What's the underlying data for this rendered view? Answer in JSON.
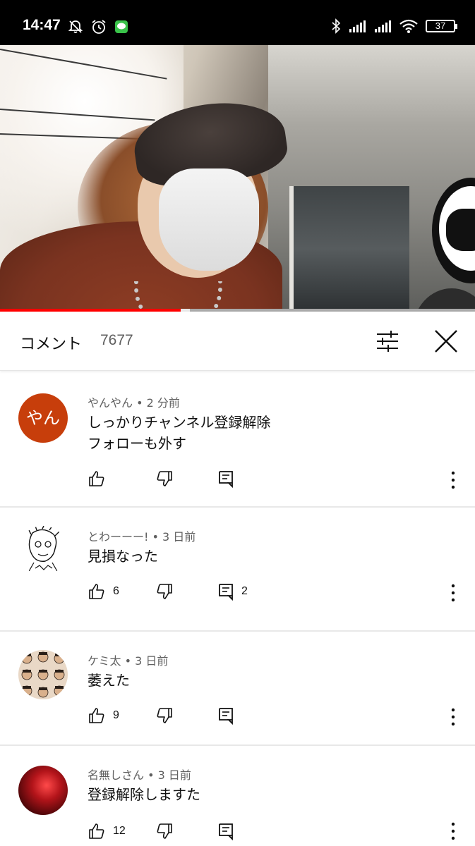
{
  "status_bar": {
    "time": "14:47",
    "left_icons": [
      "bell-off-icon",
      "alarm-icon",
      "line-app-icon"
    ],
    "right_icons": [
      "bluetooth-icon",
      "signal-icon",
      "signal-icon",
      "wifi-icon"
    ],
    "battery": "37"
  },
  "video": {
    "progress_fraction": 0.38,
    "buffer_fraction": 0.4
  },
  "comments_header": {
    "title": "コメント",
    "count": "7677",
    "filter_icon": "sliders-icon",
    "close_icon": "close-icon"
  },
  "comments": [
    {
      "avatar_text": "やん",
      "avatar_color": "#c73e0b",
      "author": "やんやん",
      "time": "2 分前",
      "lines": [
        "しっかりチャンネル登録解除",
        "フォローも外す"
      ],
      "likes": "",
      "replies": ""
    },
    {
      "avatar_text": "",
      "author": "とわーーー!",
      "time": "3 日前",
      "lines": [
        "見損なった"
      ],
      "likes": "6",
      "replies": "2"
    },
    {
      "avatar_text": "",
      "author": "ケミ太",
      "time": "3 日前",
      "lines": [
        "萎えた"
      ],
      "likes": "9",
      "replies": ""
    },
    {
      "avatar_text": "",
      "author": "名無しさん",
      "time": "3 日前",
      "lines": [
        "登録解除しますた"
      ],
      "likes": "12",
      "replies": ""
    }
  ]
}
